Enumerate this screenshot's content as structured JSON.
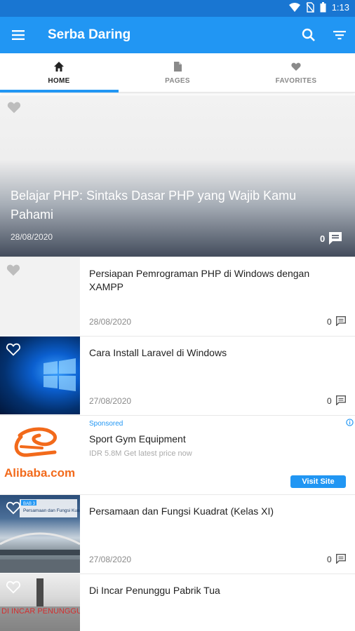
{
  "status_bar": {
    "time": "1:13"
  },
  "app_bar": {
    "title": "Serba Daring"
  },
  "tabs": [
    {
      "label": "HOME",
      "icon": "home-icon",
      "active": true
    },
    {
      "label": "PAGES",
      "icon": "page-icon",
      "active": false
    },
    {
      "label": "FAVORITES",
      "icon": "heart-icon",
      "active": false
    }
  ],
  "featured": {
    "title": "Belajar PHP: Sintaks Dasar PHP yang Wajib Kamu Pahami",
    "date": "28/08/2020",
    "comments": "0"
  },
  "articles": [
    {
      "title": "Persiapan Pemrograman PHP di Windows dengan XAMPP",
      "date": "28/08/2020",
      "comments": "0"
    },
    {
      "title": "Cara Install Laravel di Windows",
      "date": "27/08/2020",
      "comments": "0"
    },
    {
      "title": "Persamaan dan Fungsi Kuadrat (Kelas XI)",
      "date": "27/08/2020",
      "comments": "0",
      "thumb_text": "BAB 3 Persamaan dan Fungsi Kuadrat"
    },
    {
      "title": "Di Incar Penunggu Pabrik Tua",
      "thumb_text": "DI INCAR PENUNGGU PABRIK TUA"
    }
  ],
  "ad": {
    "sponsored": "Sponsored",
    "title": "Sport Gym Equipment",
    "description": "IDR 5.8M Get latest price now",
    "button": "Visit Site",
    "logo_text": "Alibaba.com"
  },
  "colors": {
    "primary": "#2196f3",
    "status_bar": "#1976d2",
    "logo_orange": "#f26a1b"
  }
}
